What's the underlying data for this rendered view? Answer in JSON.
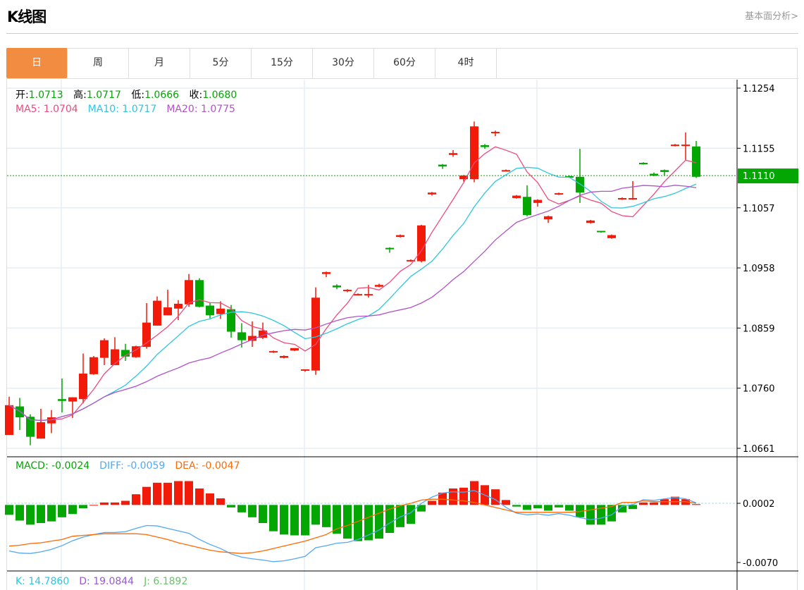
{
  "header": {
    "title": "K线图",
    "fundamental_link": "基本面分析>"
  },
  "tabs": [
    {
      "label": "日",
      "active": true
    },
    {
      "label": "周"
    },
    {
      "label": "月"
    },
    {
      "label": "5分"
    },
    {
      "label": "15分"
    },
    {
      "label": "30分"
    },
    {
      "label": "60分"
    },
    {
      "label": "4时"
    }
  ],
  "ohlc_legend": {
    "open_label": "开:",
    "open": "1.0713",
    "high_label": "高:",
    "high": "1.0717",
    "low_label": "低:",
    "low": "1.0666",
    "close_label": "收:",
    "close": "1.0680"
  },
  "ma_legend": {
    "ma5": "MA5: 1.0704",
    "ma10": "MA10: 1.0717",
    "ma20": "MA20: 1.0775"
  },
  "macd_legend": {
    "macd": "MACD: -0.0024",
    "diff": "DIFF: -0.0059",
    "dea": "DEA: -0.0047"
  },
  "kdj_legend": {
    "k": "K: 14.7860",
    "d": "D: 19.0844",
    "j": "J: 6.1892"
  },
  "current_price": "1.1110",
  "colors": {
    "up": "#f21b0a",
    "down": "#03a603",
    "ma5": "#ec4c7c",
    "ma10": "#2fc6e0",
    "ma20": "#b153c6",
    "diff": "#52a8f5",
    "dea": "#ff6a00",
    "active_tab": "#f28c40"
  },
  "chart_data": {
    "type": "candlestick",
    "price_axis": {
      "ticks": [
        "1.1254",
        "1.1155",
        "1.1057",
        "1.0958",
        "1.0859",
        "1.0760",
        "1.0661"
      ],
      "range": [
        1.0661,
        1.1254
      ]
    },
    "macd_axis": {
      "ticks": [
        "0.0002",
        "-0.0070"
      ],
      "range": [
        -0.007,
        0.0002
      ]
    },
    "candles": [
      [
        1.0683,
        1.0746,
        1.0683,
        1.0732
      ],
      [
        1.073,
        1.0744,
        1.0691,
        1.0712
      ],
      [
        1.0713,
        1.0717,
        1.0666,
        1.068
      ],
      [
        1.0677,
        1.0726,
        1.0677,
        1.0704
      ],
      [
        1.0702,
        1.0724,
        1.0686,
        1.0712
      ],
      [
        1.0742,
        1.0776,
        1.072,
        1.0739
      ],
      [
        1.0738,
        1.0745,
        1.0711,
        1.0745
      ],
      [
        1.0742,
        1.0817,
        1.0735,
        1.0784
      ],
      [
        1.0783,
        1.0813,
        1.0782,
        1.0811
      ],
      [
        1.081,
        1.0842,
        1.0798,
        1.0839
      ],
      [
        1.0798,
        1.0844,
        1.0798,
        1.0824
      ],
      [
        1.0823,
        1.0833,
        1.0805,
        1.0812
      ],
      [
        1.0811,
        1.083,
        1.081,
        1.0829
      ],
      [
        1.0828,
        1.09,
        1.0825,
        1.0868
      ],
      [
        1.0863,
        1.0911,
        1.0863,
        1.0904
      ],
      [
        1.088,
        1.0922,
        1.088,
        1.0893
      ],
      [
        1.0891,
        1.0905,
        1.0872,
        1.0899
      ],
      [
        1.0898,
        1.0948,
        1.0894,
        1.0938
      ],
      [
        1.0938,
        1.0941,
        1.0893,
        1.0894
      ],
      [
        1.0896,
        1.0901,
        1.0875,
        1.088
      ],
      [
        1.0882,
        1.0903,
        1.0874,
        1.0891
      ],
      [
        1.089,
        1.0897,
        1.0843,
        1.0853
      ],
      [
        1.0852,
        1.0867,
        1.0827,
        1.0839
      ],
      [
        1.0838,
        1.087,
        1.0828,
        1.0846
      ],
      [
        1.0843,
        1.0868,
        1.0841,
        1.0855
      ],
      [
        1.0819,
        1.0822,
        1.0818,
        1.0821
      ],
      [
        1.081,
        1.0814,
        1.0809,
        1.0813
      ],
      [
        1.0822,
        1.0826,
        1.0821,
        1.0826
      ],
      [
        1.0789,
        1.0791,
        1.0787,
        1.0791
      ],
      [
        1.0789,
        1.0926,
        1.0782,
        1.0909
      ],
      [
        1.0948,
        1.0952,
        1.0943,
        1.0951
      ],
      [
        1.0929,
        1.0931,
        1.0923,
        1.0926
      ],
      [
        1.092,
        1.0923,
        1.0918,
        1.0922
      ],
      [
        1.0913,
        1.0916,
        1.0913,
        1.0915
      ],
      [
        1.0913,
        1.093,
        1.0909,
        1.0915
      ],
      [
        1.0927,
        1.0932,
        1.0926,
        1.093
      ],
      [
        1.0991,
        1.0992,
        1.0983,
        1.099
      ],
      [
        1.1009,
        1.1013,
        1.1008,
        1.1012
      ],
      [
        1.0969,
        1.0972,
        1.0968,
        1.0971
      ],
      [
        1.0969,
        1.1029,
        1.0967,
        1.1028
      ],
      [
        1.1079,
        1.1083,
        1.1077,
        1.1082
      ],
      [
        1.1128,
        1.1129,
        1.1121,
        1.1125
      ],
      [
        1.1144,
        1.1152,
        1.1141,
        1.1147
      ],
      [
        1.1104,
        1.1111,
        1.11,
        1.111
      ],
      [
        1.1104,
        1.1199,
        1.1099,
        1.1191
      ],
      [
        1.116,
        1.1162,
        1.1154,
        1.1157
      ],
      [
        1.118,
        1.1184,
        1.1175,
        1.1182
      ],
      [
        1.1118,
        1.112,
        1.1117,
        1.1119
      ],
      [
        1.1073,
        1.1078,
        1.1072,
        1.1077
      ],
      [
        1.1075,
        1.1094,
        1.1043,
        1.1045
      ],
      [
        1.1065,
        1.1071,
        1.1059,
        1.107
      ],
      [
        1.1038,
        1.1044,
        1.1032,
        1.1043
      ],
      [
        1.1079,
        1.1082,
        1.1078,
        1.1081
      ],
      [
        1.1109,
        1.111,
        1.1106,
        1.1107
      ],
      [
        1.1108,
        1.1154,
        1.1065,
        1.1082
      ],
      [
        1.1032,
        1.1037,
        1.1031,
        1.1036
      ],
      [
        1.1019,
        1.1019,
        1.1016,
        1.1017
      ],
      [
        1.1007,
        1.1013,
        1.1006,
        1.1012
      ],
      [
        1.1071,
        1.1074,
        1.107,
        1.1073
      ],
      [
        1.1071,
        1.1101,
        1.107,
        1.1073
      ],
      [
        1.1131,
        1.1132,
        1.1128,
        1.1129
      ],
      [
        1.1113,
        1.1115,
        1.1109,
        1.111
      ],
      [
        1.1119,
        1.112,
        1.111,
        1.1116
      ],
      [
        1.1159,
        1.1162,
        1.1158,
        1.1161
      ],
      [
        1.1159,
        1.1181,
        1.1136,
        1.1161
      ],
      [
        1.1158,
        1.1167,
        1.1106,
        1.1108
      ]
    ],
    "macd_hist": [
      -0.0012,
      -0.0019,
      -0.0024,
      -0.0022,
      -0.002,
      -0.0015,
      -0.0011,
      -0.0004,
      0.0,
      0.0003,
      0.0003,
      0.0005,
      0.0013,
      0.0022,
      0.0027,
      0.0027,
      0.0029,
      0.0029,
      0.002,
      0.0014,
      0.0008,
      -0.0003,
      -0.0009,
      -0.0015,
      -0.0022,
      -0.0032,
      -0.0036,
      -0.0037,
      -0.0037,
      -0.0024,
      -0.0027,
      -0.0035,
      -0.0041,
      -0.0044,
      -0.0043,
      -0.0041,
      -0.0034,
      -0.0027,
      -0.0023,
      -0.0008,
      0.0005,
      0.0015,
      0.002,
      0.0021,
      0.0029,
      0.0024,
      0.0019,
      0.0006,
      -0.0002,
      -0.0006,
      -0.0004,
      -0.0007,
      -0.0003,
      -0.0007,
      -0.0015,
      -0.0024,
      -0.0024,
      -0.002,
      -0.0009,
      -0.0005,
      0.0003,
      0.0003,
      0.0007,
      0.001,
      0.0007,
      0.0001
    ],
    "dea": [
      -0.005,
      -0.0049,
      -0.0047,
      -0.0046,
      -0.0044,
      -0.0042,
      -0.0038,
      -0.0037,
      -0.0036,
      -0.0035,
      -0.0035,
      -0.0035,
      -0.0035,
      -0.0036,
      -0.0039,
      -0.0042,
      -0.0046,
      -0.0049,
      -0.0052,
      -0.0055,
      -0.0057,
      -0.0058,
      -0.0059,
      -0.0058,
      -0.0056,
      -0.0053,
      -0.005,
      -0.0047,
      -0.0044,
      -0.004,
      -0.0036,
      -0.0029,
      -0.0025,
      -0.002,
      -0.0015,
      -0.001,
      -0.0005,
      -0.0001,
      0.0002,
      0.0006,
      0.0007,
      0.0007,
      0.0006,
      0.0005,
      0.0003,
      0.0,
      -0.0003,
      -0.0006,
      -0.0009,
      -0.0009,
      -0.0009,
      -0.0009,
      -0.0009,
      -0.0009,
      -0.0008,
      -0.0006,
      -0.0004,
      -0.0002,
      0.0003,
      0.0003,
      0.0005,
      0.0004,
      0.0004,
      0.0004,
      0.0004,
      0.0002
    ]
  }
}
